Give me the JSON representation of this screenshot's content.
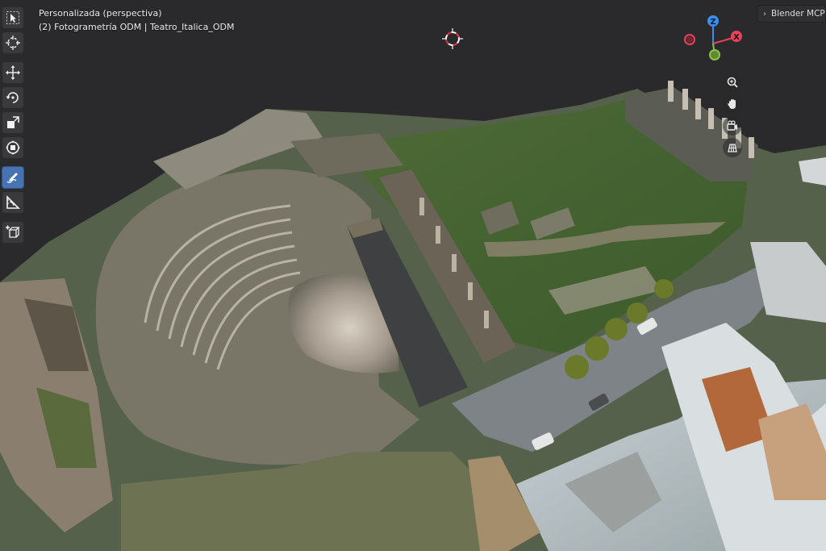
{
  "viewport": {
    "title": "Personalizada (perspectiva)",
    "subtitle": "(2) Fotogrametría ODM | Teatro_Italica_ODM"
  },
  "sidebar_tab": {
    "label": "Blender MCP"
  },
  "gizmo": {
    "axis_z_label": "Z",
    "axis_x_label": "X",
    "axis_y_label": "",
    "colors": {
      "x": "#e8435a",
      "y": "#8bc34a",
      "z": "#3a8ef0"
    }
  },
  "toolbar": {
    "tools": [
      {
        "name": "select-box-tool",
        "icon": "cursor-arrow-icon",
        "active": false
      },
      {
        "name": "cursor-tool",
        "icon": "crosshair-cursor-icon",
        "active": false
      },
      {
        "name": "move-tool",
        "icon": "move-arrows-icon",
        "active": false
      },
      {
        "name": "rotate-tool",
        "icon": "rotate-icon",
        "active": false
      },
      {
        "name": "scale-tool",
        "icon": "scale-icon",
        "active": false
      },
      {
        "name": "transform-tool",
        "icon": "transform-icon",
        "active": false
      },
      {
        "name": "annotate-tool",
        "icon": "pencil-annotate-icon",
        "active": true
      },
      {
        "name": "measure-tool",
        "icon": "ruler-measure-icon",
        "active": false
      },
      {
        "name": "add-cube-tool",
        "icon": "add-cube-icon",
        "active": false
      }
    ]
  },
  "nav": {
    "buttons": [
      "zoom-icon",
      "hand-pan-icon",
      "camera-icon",
      "grid-ortho-icon"
    ]
  }
}
